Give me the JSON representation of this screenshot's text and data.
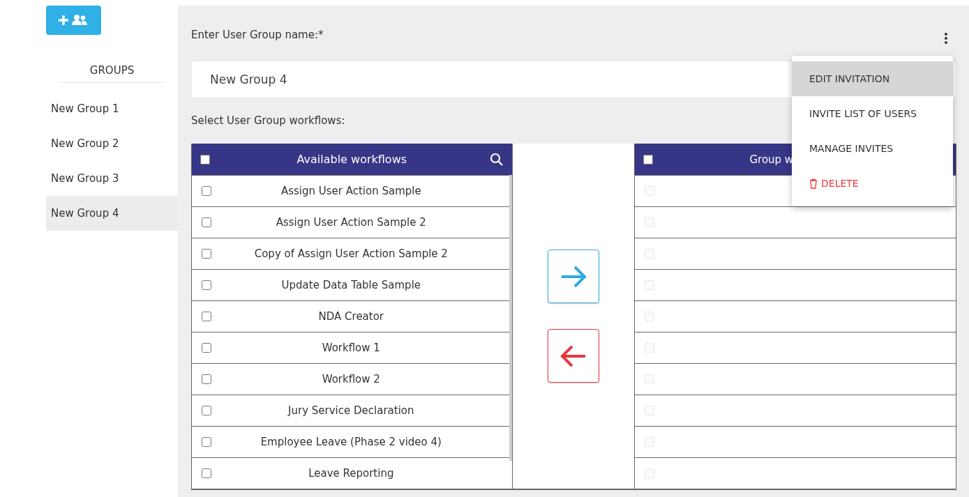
{
  "sidebar": {
    "heading": "GROUPS",
    "items": [
      {
        "label": "New Group 1",
        "selected": false
      },
      {
        "label": "New Group 2",
        "selected": false
      },
      {
        "label": "New Group 3",
        "selected": false
      },
      {
        "label": "New Group 4",
        "selected": true
      }
    ]
  },
  "form": {
    "name_label": "Enter User Group name:*",
    "name_value": "New Group 4",
    "workflows_label": "Select User Group workflows:"
  },
  "available": {
    "header": "Available workflows",
    "all_checked": false,
    "rows": [
      {
        "name": "Assign User Action Sample",
        "checked": false
      },
      {
        "name": "Assign User Action Sample 2",
        "checked": false
      },
      {
        "name": "Copy of Assign User Action Sample 2",
        "checked": false
      },
      {
        "name": "Update Data Table Sample",
        "checked": false
      },
      {
        "name": "NDA Creator",
        "checked": false
      },
      {
        "name": "Workflow 1",
        "checked": false
      },
      {
        "name": "Workflow 2",
        "checked": false
      },
      {
        "name": "Jury Service Declaration",
        "checked": false
      },
      {
        "name": "Employee Leave (Phase 2 video 4)",
        "checked": false
      },
      {
        "name": "Leave Reporting",
        "checked": false
      }
    ]
  },
  "group": {
    "header": "Group w",
    "all_checked": false,
    "rows": [
      {
        "disabled": true
      },
      {
        "disabled": true
      },
      {
        "disabled": true
      },
      {
        "disabled": true
      },
      {
        "disabled": true
      },
      {
        "disabled": true
      },
      {
        "disabled": true
      },
      {
        "disabled": true
      },
      {
        "disabled": true
      },
      {
        "disabled": true
      }
    ]
  },
  "menu": {
    "items": [
      {
        "label": "EDIT INVITATION",
        "kind": "normal",
        "selected": true
      },
      {
        "label": "INVITE LIST OF USERS",
        "kind": "normal",
        "selected": false
      },
      {
        "label": "MANAGE INVITES",
        "kind": "normal",
        "selected": false
      },
      {
        "label": "DELETE",
        "kind": "danger",
        "selected": false
      }
    ]
  }
}
